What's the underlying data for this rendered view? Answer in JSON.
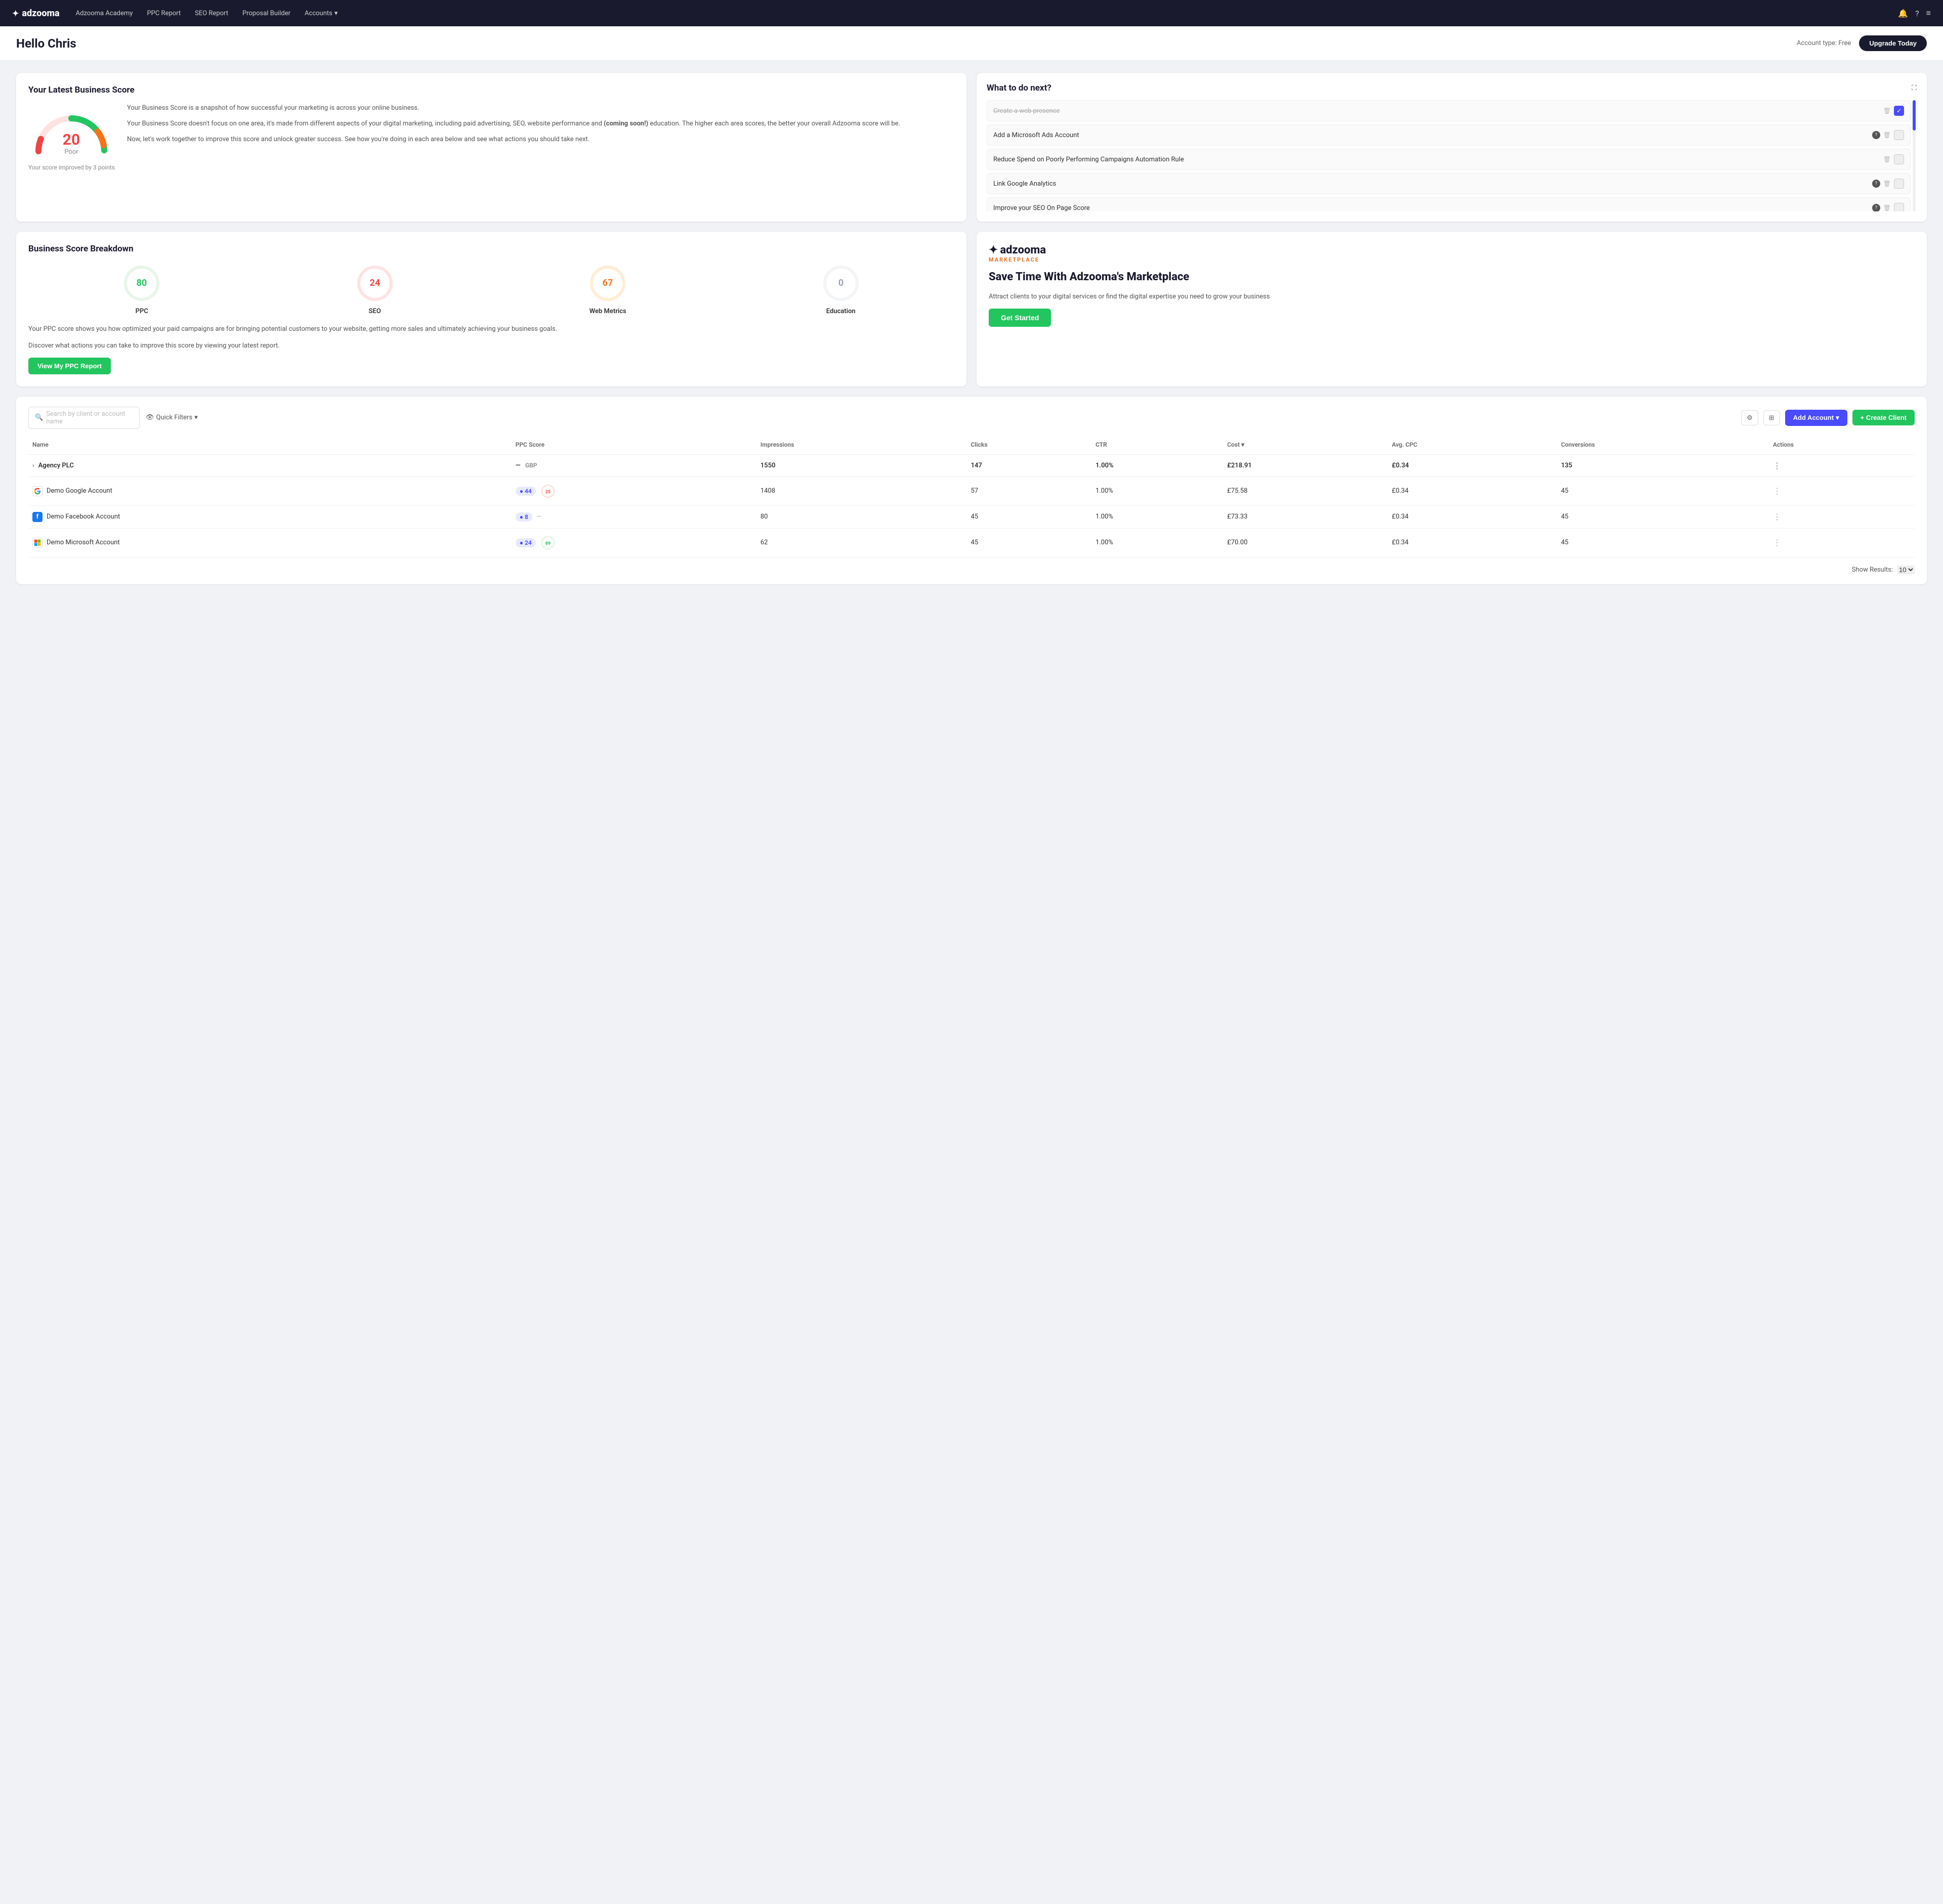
{
  "nav": {
    "logo": "adzooma",
    "links": [
      "Adzooma Academy",
      "PPC Report",
      "SEO Report",
      "Proposal Builder"
    ],
    "accounts_label": "Accounts",
    "icons": [
      "bell",
      "question",
      "menu"
    ]
  },
  "header": {
    "greeting": "Hello Chris",
    "account_type_label": "Account type: Free",
    "upgrade_btn": "Upgrade Today"
  },
  "business_score_card": {
    "title": "Your Latest Business Score",
    "score": "20",
    "score_label": "Poor",
    "improved_text": "Your score improved by 3 points",
    "desc1": "Your Business Score is a snapshot of how successful your marketing is across your online business.",
    "desc2": "Your Business Score doesn't focus on one area, it's made from different aspects of your digital marketing, including paid advertising, SEO, website performance and ",
    "desc2_bold": "(coming soon!)",
    "desc2_end": " education. The higher each area scores, the better your overall Adzooma score will be.",
    "desc3": "Now, let's work together to improve this score and unlock greater success. See how you're doing in each area below and see what actions you should take next."
  },
  "what_next_card": {
    "title": "What to do next?",
    "items": [
      {
        "text": "Create a web presence",
        "checked": true,
        "has_help": false
      },
      {
        "text": "Add a Microsoft Ads Account",
        "checked": false,
        "has_help": true
      },
      {
        "text": "Reduce Spend on Poorly Performing Campaigns Automation Rule",
        "checked": false,
        "has_help": false
      },
      {
        "text": "Link Google Analytics",
        "checked": false,
        "has_help": true
      },
      {
        "text": "Improve your SEO On Page Score",
        "checked": false,
        "has_help": true
      }
    ]
  },
  "breakdown_card": {
    "title": "Business Score Breakdown",
    "scores": [
      {
        "value": 80,
        "label": "PPC",
        "color": "#22c55e",
        "track": "#e8f5e9"
      },
      {
        "value": 24,
        "label": "SEO",
        "color": "#ef4444",
        "track": "#fee2e2"
      },
      {
        "value": 67,
        "label": "Web Metrics",
        "color": "#f97316",
        "track": "#ffedd5"
      },
      {
        "value": 0,
        "label": "Education",
        "color": "#d1d5db",
        "track": "#f3f4f6"
      }
    ],
    "desc1": "Your PPC score shows you how optimized your paid campaigns are for bringing potential customers to your website, getting more sales and ultimately achieving your business goals.",
    "desc2": "Discover what actions you can take to improve this score by viewing your latest report.",
    "btn_label": "View My PPC Report"
  },
  "marketplace_card": {
    "logo": "adzooma",
    "logo_sub": "MARKETPLACE",
    "headline": "Save Time With Adzooma's Marketplace",
    "desc": "Attract clients to your digital services or find the digital expertise you need to grow your business",
    "btn_label": "Get Started"
  },
  "accounts_section": {
    "search_placeholder": "Search by client or account name",
    "quick_filters_label": "Quick Filters",
    "add_account_btn": "Add Account",
    "create_client_btn": "+ Create Client",
    "show_results_label": "Show Results:",
    "show_results_value": "10",
    "columns": [
      "Name",
      "PPC Score",
      "Impressions",
      "Clicks",
      "CTR",
      "Cost",
      "Avg. CPC",
      "Conversions",
      "Actions"
    ],
    "rows": [
      {
        "name": "Agency PLC",
        "is_agency": true,
        "platform": null,
        "ppc_score": "—",
        "currency": "GBP",
        "impressions": "1550",
        "clicks": "147",
        "ctr": "1.00%",
        "cost": "£218.91",
        "avg_cpc": "£0.34",
        "conversions": "135"
      },
      {
        "name": "Demo Google Account",
        "is_agency": false,
        "platform": "google",
        "ppc_score_badge": "44",
        "ppc_score_circle": "25",
        "ppc_score_circle_color": "#ef4444",
        "impressions": "1408",
        "clicks": "57",
        "ctr": "1.00%",
        "cost": "£75.58",
        "avg_cpc": "£0.34",
        "conversions": "45"
      },
      {
        "name": "Demo Facebook Account",
        "is_agency": false,
        "platform": "facebook",
        "ppc_score_badge": "8",
        "ppc_score_circle": "—",
        "impressions": "80",
        "clicks": "45",
        "ctr": "1.00%",
        "cost": "£73.33",
        "avg_cpc": "£0.34",
        "conversions": "45"
      },
      {
        "name": "Demo Microsoft Account",
        "is_agency": false,
        "platform": "microsoft",
        "ppc_score_badge": "24",
        "ppc_score_circle": "89",
        "ppc_score_circle_color": "#22c55e",
        "impressions": "62",
        "clicks": "45",
        "ctr": "1.00%",
        "cost": "£70.00",
        "avg_cpc": "£0.34",
        "conversions": "45"
      }
    ]
  }
}
